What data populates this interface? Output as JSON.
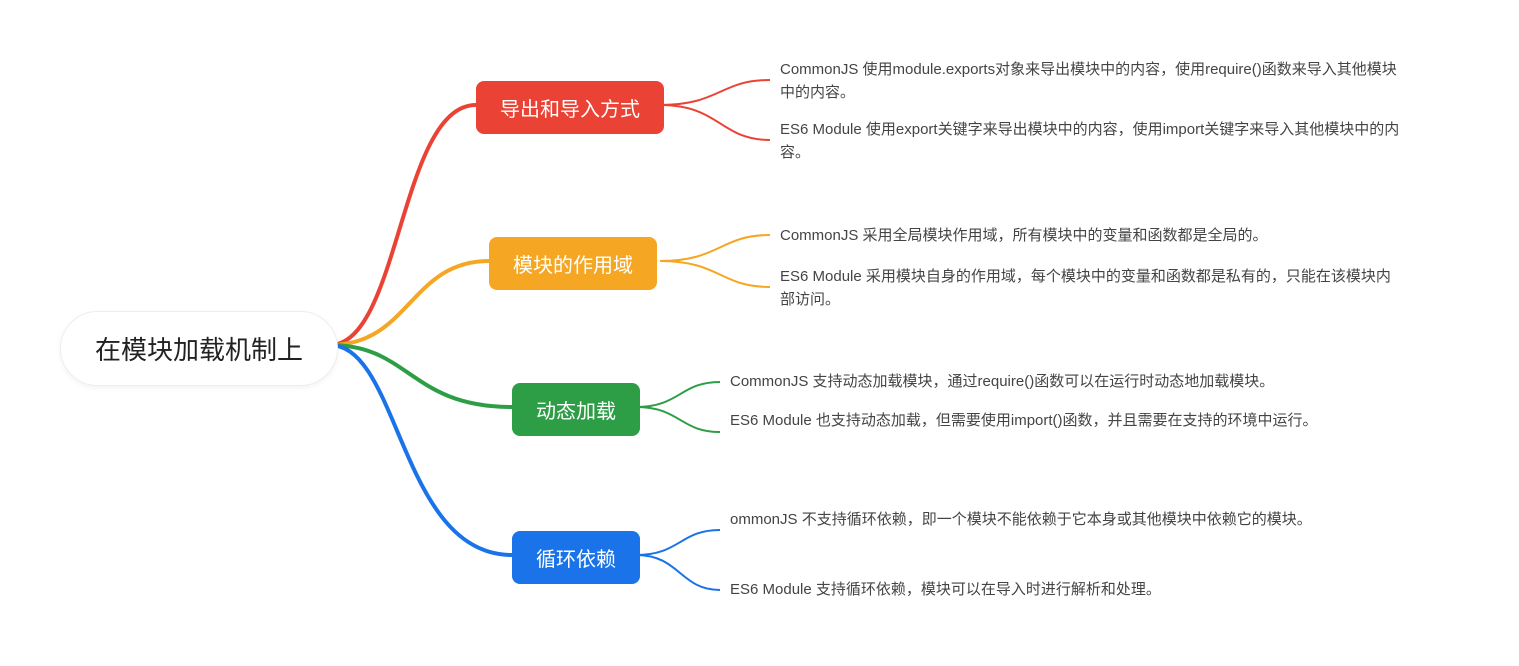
{
  "root": {
    "label": "在模块加载机制上"
  },
  "branches": [
    {
      "key": "export_import",
      "label": "导出和导入方式",
      "color": "#ea4335",
      "leaves": [
        "CommonJS 使用module.exports对象来导出模块中的内容，使用require()函数来导入其他模块中的内容。",
        "ES6 Module 使用export关键字来导出模块中的内容，使用import关键字来导入其他模块中的内容。"
      ]
    },
    {
      "key": "scope",
      "label": "模块的作用域",
      "color": "#f5a623",
      "leaves": [
        "CommonJS 采用全局模块作用域，所有模块中的变量和函数都是全局的。",
        "ES6 Module 采用模块自身的作用域，每个模块中的变量和函数都是私有的，只能在该模块内部访问。"
      ]
    },
    {
      "key": "dynamic",
      "label": "动态加载",
      "color": "#2e9e46",
      "leaves": [
        "CommonJS 支持动态加载模块，通过require()函数可以在运行时动态地加载模块。",
        "ES6 Module 也支持动态加载，但需要使用import()函数，并且需要在支持的环境中运行。"
      ]
    },
    {
      "key": "circular",
      "label": "循环依赖",
      "color": "#1a73e8",
      "leaves": [
        "ommonJS 不支持循环依赖，即一个模块不能依赖于它本身或其他模块中依赖它的模块。",
        "ES6 Module 支持循环依赖，模块可以在导入时进行解析和处理。"
      ]
    }
  ]
}
